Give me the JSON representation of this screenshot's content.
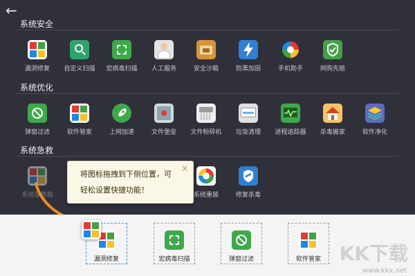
{
  "sections": [
    {
      "title": "系统安全",
      "items": [
        {
          "label": "漏洞修复",
          "icon": "windows-shield-icon",
          "color": "#ffffff"
        },
        {
          "label": "自定义扫描",
          "icon": "magnifier-icon",
          "color": "#2fa36b"
        },
        {
          "label": "宏病毒扫描",
          "icon": "scan-icon",
          "color": "#3fa84a"
        },
        {
          "label": "人工服务",
          "icon": "person-icon",
          "color": "#d9d9d9"
        },
        {
          "label": "安全沙箱",
          "icon": "sandbox-icon",
          "color": "#d8943c"
        },
        {
          "label": "防黑加固",
          "icon": "lightning-icon",
          "color": "#2f7fd2"
        },
        {
          "label": "手机助手",
          "icon": "phone-ball-icon",
          "color": "#e85a32"
        },
        {
          "label": "网购先赔",
          "icon": "shield-check-icon",
          "color": "#43a047"
        }
      ]
    },
    {
      "title": "系统优化",
      "items": [
        {
          "label": "弹窗过滤",
          "icon": "block-icon",
          "color": "#3fa84a"
        },
        {
          "label": "软件管家",
          "icon": "apps-icon",
          "color": "#e53935"
        },
        {
          "label": "上网加速",
          "icon": "rocket-icon",
          "color": "#3fa84a"
        },
        {
          "label": "文件堡垒",
          "icon": "vault-icon",
          "color": "#d0d0d0"
        },
        {
          "label": "文件粉碎机",
          "icon": "shredder-icon",
          "color": "#e6e6e6"
        },
        {
          "label": "垃圾清理",
          "icon": "clean-icon",
          "color": "#d9d9d9"
        },
        {
          "label": "进程追踪器",
          "icon": "monitor-icon",
          "color": "#3fa84a"
        },
        {
          "label": "杀毒搬家",
          "icon": "house-icon",
          "color": "#e6a23c"
        },
        {
          "label": "软件净化",
          "icon": "layers-icon",
          "color": "#7e57c2"
        }
      ]
    },
    {
      "title": "系统急救",
      "items": [
        {
          "label": "系统急救箱",
          "icon": "aid-icon",
          "color": "#e53935"
        },
        {
          "label": "系统重装",
          "icon": "reload-icon",
          "color": "#2f7fd2"
        },
        {
          "label": "修复杀毒",
          "icon": "repair-icon",
          "color": "#2f7fd2"
        }
      ]
    }
  ],
  "tooltip": {
    "line1": "将图标拖拽到下侧位置，可",
    "line2": "轻松设置快捷功能！",
    "close": "×"
  },
  "tray": [
    {
      "label": "漏洞修复",
      "icon": "windows-shield-icon"
    },
    {
      "label": "宏病毒扫描",
      "icon": "scan-icon"
    },
    {
      "label": "弹窗过滤",
      "icon": "block-icon"
    },
    {
      "label": "软件管家",
      "icon": "apps-icon"
    }
  ],
  "back_glyph": "←",
  "watermark": "KK下载",
  "watermark_url": "www.kkx.net"
}
